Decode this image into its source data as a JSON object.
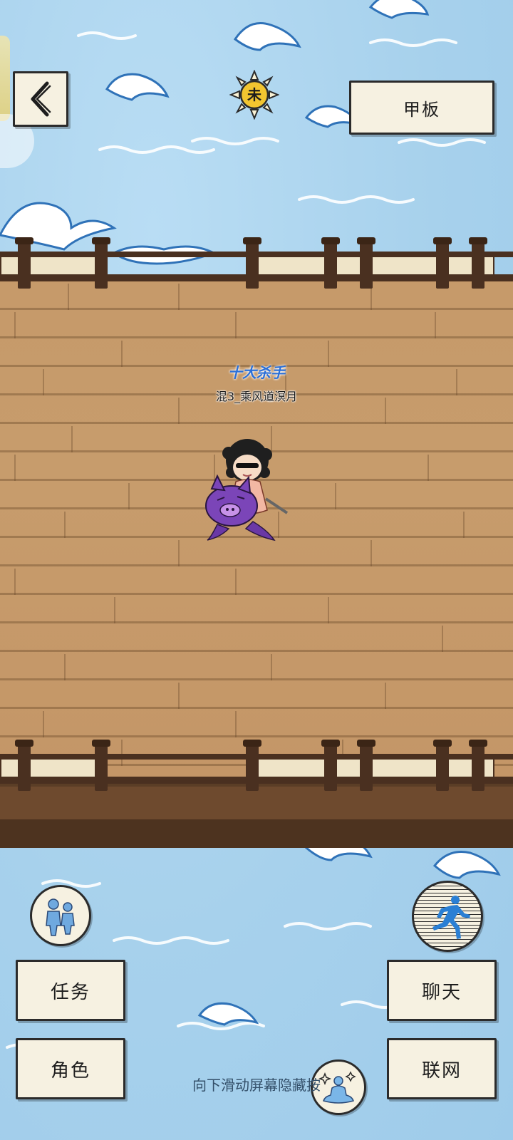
{
  "location": {
    "label": "甲板"
  },
  "time_badge": {
    "glyph": "未",
    "icon": "sun-icon"
  },
  "player": {
    "title": "十大杀手",
    "name": "混3_乘风道溟月"
  },
  "left_menu": {
    "quest_label": "任务",
    "role_label": "角色",
    "social_icon": "people-icon"
  },
  "right_menu": {
    "chat_label": "聊天",
    "network_label": "联网",
    "run_icon": "running-icon",
    "meditate_icon": "meditate-icon"
  },
  "hint": "向下滑动屏幕隐藏按",
  "colors": {
    "sea": "#a9d3ee",
    "deck": "#c69a6a",
    "rail": "#4a3020",
    "paper": "#f6f1e1",
    "title_blue": "#2a6fd8"
  }
}
